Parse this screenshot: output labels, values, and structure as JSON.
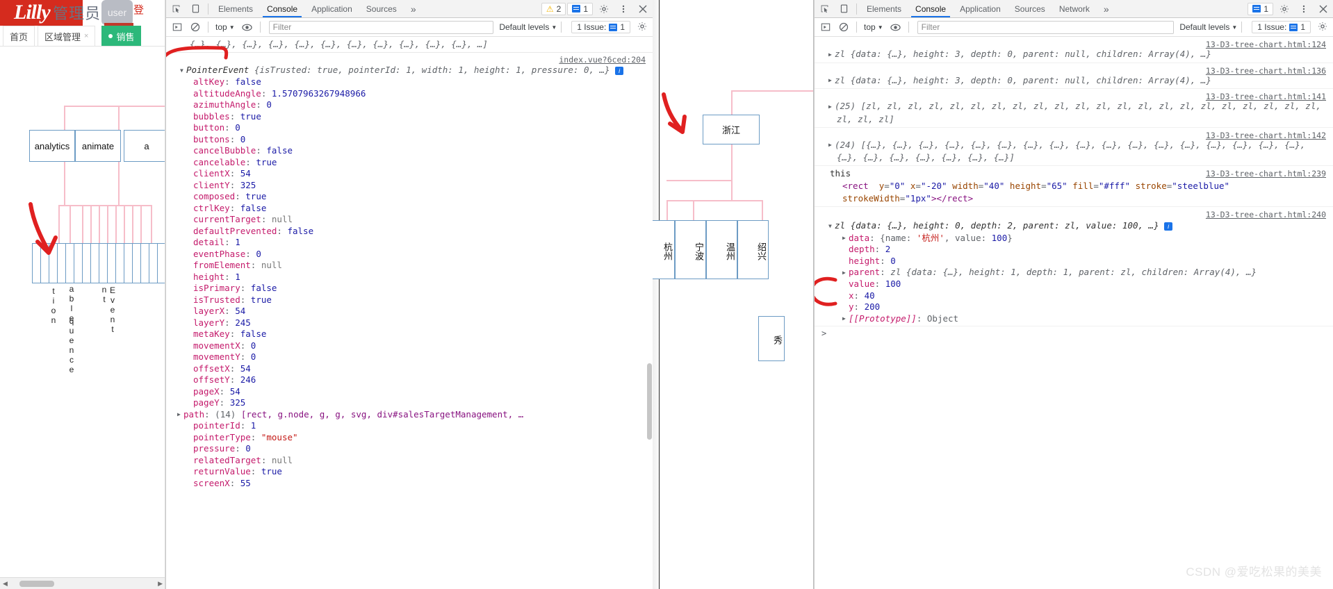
{
  "webapp": {
    "brand": "Lilly",
    "admin_label": "管理员",
    "user_chip": "user",
    "cn_red": "登",
    "tabs": [
      {
        "label": "首页",
        "closable": false,
        "active": false
      },
      {
        "label": "区域管理",
        "closable": true,
        "active": false
      },
      {
        "label": "销售",
        "closable": false,
        "active": true
      }
    ],
    "d3_nodes": [
      "analytics",
      "animate",
      "a"
    ],
    "d3_vertical_labels": [
      "tion",
      "able",
      "quence",
      "nt",
      "Event"
    ],
    "scrollbar": {
      "left_arrow": "◀",
      "right_arrow": "▶"
    }
  },
  "left_devtools": {
    "tabs": [
      {
        "label": "Elements",
        "active": false
      },
      {
        "label": "Console",
        "active": true
      },
      {
        "label": "Application",
        "active": false
      },
      {
        "label": "Sources",
        "active": false
      }
    ],
    "more_tabs_icon": "chevron-double-right-icon",
    "warning_badge": {
      "icon": "warning-triangle-icon",
      "count": "2"
    },
    "issue_badge": {
      "icon": "issue-square-icon",
      "count": "1"
    },
    "settings_icon": "gear-icon",
    "more_icon": "kebab-menu-icon",
    "close_icon": "close-icon",
    "toolbar": {
      "execute_icon": "execute-script-icon",
      "clear_icon": "clear-console-icon",
      "context": "top",
      "eye_icon": "live-expression-icon",
      "filter_placeholder": "Filter",
      "levels": "Default levels",
      "issue_text": "1 Issue:",
      "issue_count": "1",
      "gear_icon": "gear-icon"
    },
    "logs": {
      "truncated_array_line": "{…}, {…}, {…}, {…}, {…}, {…}, {…}, {…}, {…}, {…}, {…}, …]",
      "source_link": "index.vue?6ced:204",
      "header": {
        "type": "PointerEvent",
        "preview": "{isTrusted: true, pointerId: 1, width: 1, height: 1, pressure: 0, …}"
      },
      "properties": [
        {
          "name": "altKey",
          "value": "false",
          "kind": "bool"
        },
        {
          "name": "altitudeAngle",
          "value": "1.5707963267948966",
          "kind": "num"
        },
        {
          "name": "azimuthAngle",
          "value": "0",
          "kind": "num"
        },
        {
          "name": "bubbles",
          "value": "true",
          "kind": "bool"
        },
        {
          "name": "button",
          "value": "0",
          "kind": "num"
        },
        {
          "name": "buttons",
          "value": "0",
          "kind": "num"
        },
        {
          "name": "cancelBubble",
          "value": "false",
          "kind": "bool"
        },
        {
          "name": "cancelable",
          "value": "true",
          "kind": "bool"
        },
        {
          "name": "clientX",
          "value": "54",
          "kind": "num"
        },
        {
          "name": "clientY",
          "value": "325",
          "kind": "num"
        },
        {
          "name": "composed",
          "value": "true",
          "kind": "bool"
        },
        {
          "name": "ctrlKey",
          "value": "false",
          "kind": "bool"
        },
        {
          "name": "currentTarget",
          "value": "null",
          "kind": "null"
        },
        {
          "name": "defaultPrevented",
          "value": "false",
          "kind": "bool"
        },
        {
          "name": "detail",
          "value": "1",
          "kind": "num"
        },
        {
          "name": "eventPhase",
          "value": "0",
          "kind": "num"
        },
        {
          "name": "fromElement",
          "value": "null",
          "kind": "null"
        },
        {
          "name": "height",
          "value": "1",
          "kind": "num"
        },
        {
          "name": "isPrimary",
          "value": "false",
          "kind": "bool"
        },
        {
          "name": "isTrusted",
          "value": "true",
          "kind": "bool"
        },
        {
          "name": "layerX",
          "value": "54",
          "kind": "num"
        },
        {
          "name": "layerY",
          "value": "245",
          "kind": "num"
        },
        {
          "name": "metaKey",
          "value": "false",
          "kind": "bool"
        },
        {
          "name": "movementX",
          "value": "0",
          "kind": "num"
        },
        {
          "name": "movementY",
          "value": "0",
          "kind": "num"
        },
        {
          "name": "offsetX",
          "value": "54",
          "kind": "num"
        },
        {
          "name": "offsetY",
          "value": "246",
          "kind": "num"
        },
        {
          "name": "pageX",
          "value": "54",
          "kind": "num"
        },
        {
          "name": "pageY",
          "value": "325",
          "kind": "num"
        }
      ],
      "path_row": {
        "name": "path",
        "count": "(14)",
        "value": "[rect, g.node, g, g, svg, div#salesTargetManagement, …"
      },
      "properties_after_path": [
        {
          "name": "pointerId",
          "value": "1",
          "kind": "num"
        },
        {
          "name": "pointerType",
          "value": "\"mouse\"",
          "kind": "str"
        },
        {
          "name": "pressure",
          "value": "0",
          "kind": "num"
        },
        {
          "name": "relatedTarget",
          "value": "null",
          "kind": "null"
        },
        {
          "name": "returnValue",
          "value": "true",
          "kind": "bool"
        },
        {
          "name": "screenX",
          "value": "55",
          "kind": "num"
        }
      ]
    }
  },
  "mid_page": {
    "root_label": "浙江",
    "children": [
      "杭州",
      "宁波",
      "温州",
      "绍兴"
    ],
    "partial_left_label": "杭州",
    "detached_label": "秀"
  },
  "right_devtools": {
    "tabs": [
      {
        "label": "Elements",
        "active": false
      },
      {
        "label": "Console",
        "active": true
      },
      {
        "label": "Application",
        "active": false
      },
      {
        "label": "Sources",
        "active": false
      },
      {
        "label": "Network",
        "active": false
      }
    ],
    "more_tabs_icon": "chevron-double-right-icon",
    "issue_badge": {
      "icon": "issue-square-icon",
      "count": "1"
    },
    "settings_icon": "gear-icon",
    "more_icon": "kebab-menu-icon",
    "close_icon": "close-icon",
    "toolbar": {
      "execute_icon": "execute-script-icon",
      "clear_icon": "clear-console-icon",
      "context": "top",
      "eye_icon": "live-expression-icon",
      "filter_placeholder": "Filter",
      "levels": "Default levels",
      "issue_text": "1 Issue:",
      "issue_count": "1",
      "gear_icon": "gear-icon"
    },
    "logs": [
      {
        "source": "13-D3-tree-chart.html:124",
        "text": "zl {data: {…}, height: 3, depth: 0, parent: null, children: Array(4), …}"
      },
      {
        "source": "13-D3-tree-chart.html:136",
        "text": "zl {data: {…}, height: 3, depth: 0, parent: null, children: Array(4), …}"
      },
      {
        "source": "13-D3-tree-chart.html:141",
        "text": "(25) [zl, zl, zl, zl, zl, zl, zl, zl, zl, zl, zl, zl, zl, zl, zl, zl, zl, zl, zl, zl, zl, zl, zl, zl, zl]"
      },
      {
        "source": "13-D3-tree-chart.html:142",
        "text": "(24) [{…}, {…}, {…}, {…}, {…}, {…}, {…}, {…}, {…}, {…}, {…}, {…}, {…}, {…}, {…}, {…}, {…}, {…}, {…}, {…}, {…}, {…}, {…}, {…}]"
      }
    ],
    "this_log": {
      "label": "this",
      "source": "13-D3-tree-chart.html:239",
      "markup": "<rect y=\"0\" x=\"-20\" width=\"40\" height=\"65\" fill=\"#fff\" stroke=\"steelblue\" strokeWidth=\"1px\"></rect>",
      "attrs": [
        {
          "name": "y",
          "value": "\"0\""
        },
        {
          "name": "x",
          "value": "\"-20\""
        },
        {
          "name": "width",
          "value": "\"40\""
        },
        {
          "name": "height",
          "value": "\"65\""
        },
        {
          "name": "fill",
          "value": "\"#fff\""
        },
        {
          "name": "stroke",
          "value": "\"steelblue\""
        },
        {
          "name": "strokeWidth",
          "value": "\"1px\""
        }
      ]
    },
    "expanded_log": {
      "source": "13-D3-tree-chart.html:240",
      "header": "zl {data: {…}, height: 0, depth: 2, parent: zl, value: 100, …}",
      "properties": [
        {
          "name": "data",
          "value": "{name: '杭州', value: 100}",
          "expandable": true
        },
        {
          "name": "depth",
          "value": "2",
          "kind": "num"
        },
        {
          "name": "height",
          "value": "0",
          "kind": "num"
        },
        {
          "name": "parent",
          "value": "zl {data: {…}, height: 1, depth: 1, parent: zl, children: Array(4), …}",
          "expandable": true
        },
        {
          "name": "value",
          "value": "100",
          "kind": "num"
        },
        {
          "name": "x",
          "value": "40",
          "kind": "num"
        },
        {
          "name": "y",
          "value": "200",
          "kind": "num"
        },
        {
          "name": "[[Prototype]]",
          "value": "Object",
          "expandable": true
        }
      ]
    },
    "prompt": ">"
  },
  "watermark": "CSDN @爱吃松果的美美",
  "colors": {
    "lilly_red": "#d52b1e",
    "accent_blue": "#1a73e8",
    "tab_green": "#2cb87a",
    "node_stroke": "#6c9bc4",
    "link_pink": "#f6bdc9",
    "annotation_red": "#e02020"
  }
}
